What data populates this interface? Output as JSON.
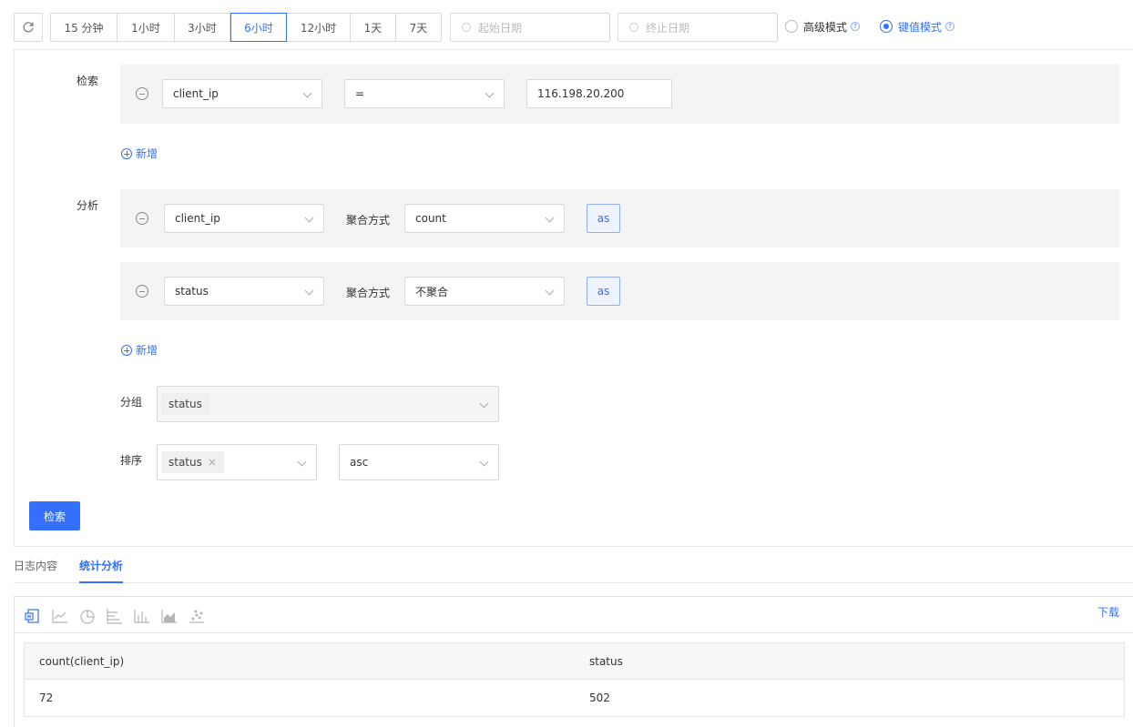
{
  "toolbar": {
    "time_ranges": [
      "15 分钟",
      "1小时",
      "3小时",
      "6小时",
      "12小时",
      "1天",
      "7天"
    ],
    "active_range": "6小时",
    "start_date_placeholder": "起始日期",
    "end_date_placeholder": "终止日期",
    "mode_advanced": "高级模式",
    "mode_keyvalue": "键值模式",
    "selected_mode": "键值模式"
  },
  "search": {
    "label": "检索",
    "conditions": [
      {
        "field": "client_ip",
        "operator": "=",
        "value": "116.198.20.200"
      }
    ],
    "add_label": "新增"
  },
  "analysis": {
    "label": "分析",
    "agg_label": "聚合方式",
    "as_label": "as",
    "rows": [
      {
        "field": "client_ip",
        "agg": "count"
      },
      {
        "field": "status",
        "agg": "不聚合"
      }
    ],
    "add_label": "新增"
  },
  "group": {
    "label": "分组",
    "tags": [
      "status"
    ]
  },
  "sort": {
    "label": "排序",
    "tags": [
      "status"
    ],
    "order": "asc"
  },
  "search_button": "检索",
  "tabs": [
    "日志内容",
    "统计分析"
  ],
  "active_tab": "统计分析",
  "result": {
    "download_label": "下载",
    "chart_icons": [
      "excel-icon",
      "line-chart-icon",
      "pie-chart-icon",
      "bar-horizontal-icon",
      "bar-chart-icon",
      "area-chart-icon",
      "scatter-chart-icon"
    ],
    "columns": [
      "count(client_ip)",
      "status"
    ],
    "rows": [
      [
        "72",
        "502"
      ]
    ]
  },
  "colors": {
    "accent": "#3370ff",
    "row_bg": "#f4f4f4",
    "border": "#d9d9d9"
  }
}
